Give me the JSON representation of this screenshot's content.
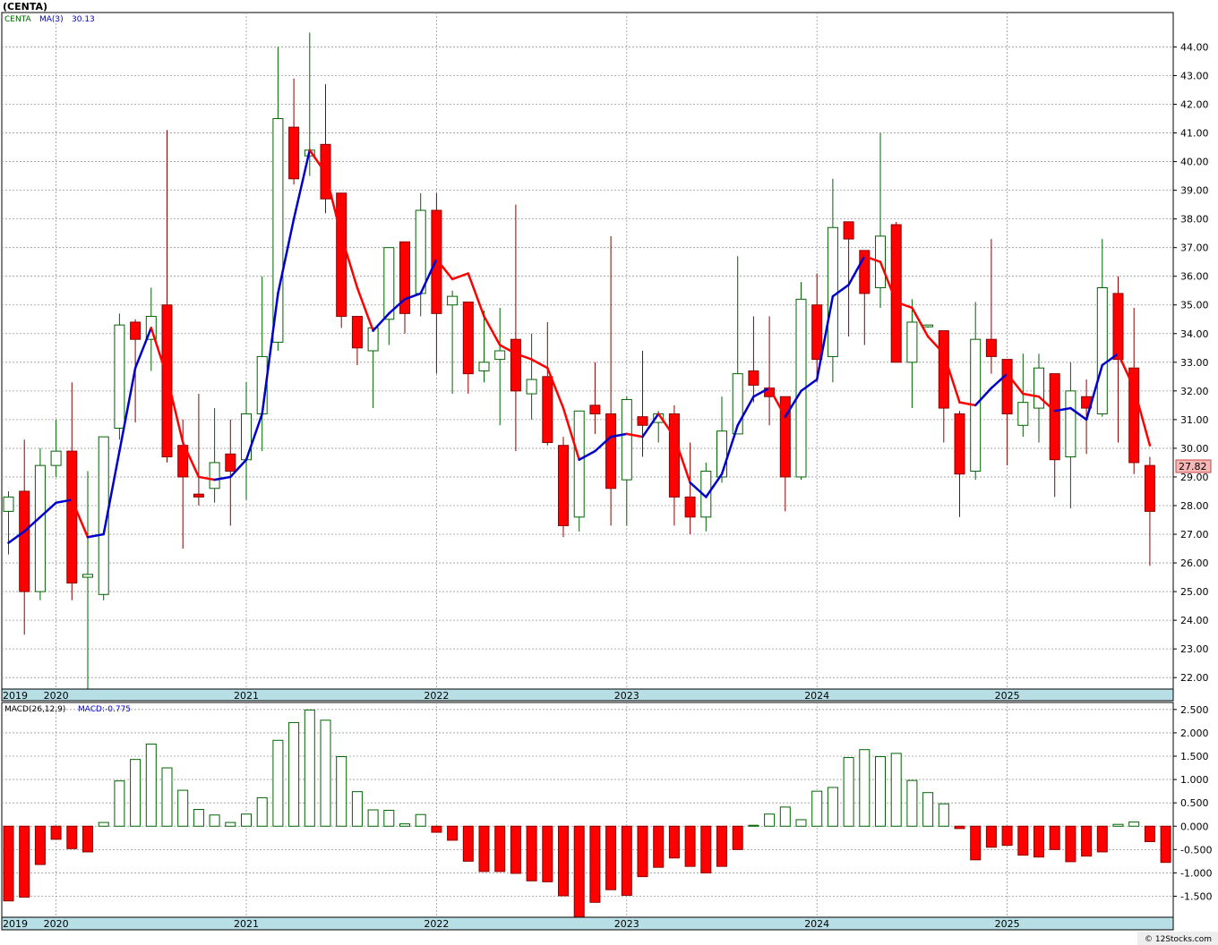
{
  "chart_data": [
    {
      "type": "candlestick",
      "title": "(CENTA)",
      "legend": [
        {
          "label": "CENTA",
          "color": "#006400"
        },
        {
          "label": "MA(3)",
          "color": "#0000cc"
        },
        {
          "label": "30.13",
          "color": "#0000cc"
        }
      ],
      "last_price_label": "27.82",
      "ylim": [
        21.6,
        45.2
      ],
      "y_ticks": [
        "22.00",
        "23.00",
        "24.00",
        "25.00",
        "26.00",
        "27.00",
        "28.00",
        "29.00",
        "30.00",
        "31.00",
        "32.00",
        "33.00",
        "34.00",
        "35.00",
        "36.00",
        "37.00",
        "38.00",
        "39.00",
        "40.00",
        "41.00",
        "42.00",
        "43.00",
        "44.00"
      ],
      "x_labels": [
        {
          "label": "2019",
          "index": -0.3
        },
        {
          "label": "2020",
          "index": 3.0
        },
        {
          "label": "2021",
          "index": 15.0
        },
        {
          "label": "2022",
          "index": 27.0
        },
        {
          "label": "2023",
          "index": 39.0
        },
        {
          "label": "2024",
          "index": 51.0
        },
        {
          "label": "2025",
          "index": 63.0
        }
      ],
      "candles": [
        [
          27.8,
          28.5,
          26.3,
          28.3
        ],
        [
          28.5,
          30.3,
          23.5,
          25.0
        ],
        [
          25.0,
          30.0,
          24.7,
          29.4
        ],
        [
          29.4,
          31.0,
          29.0,
          29.9
        ],
        [
          29.9,
          32.3,
          24.7,
          25.3
        ],
        [
          25.5,
          29.2,
          21.5,
          25.6
        ],
        [
          24.9,
          30.4,
          24.7,
          30.4
        ],
        [
          30.7,
          34.7,
          30.3,
          34.3
        ],
        [
          34.4,
          34.5,
          30.9,
          33.8
        ],
        [
          33.8,
          35.6,
          32.7,
          34.6
        ],
        [
          35.0,
          41.1,
          29.5,
          29.7
        ],
        [
          30.1,
          31.0,
          26.5,
          29.0
        ],
        [
          28.4,
          31.9,
          28.0,
          28.3
        ],
        [
          28.6,
          31.4,
          28.1,
          29.5
        ],
        [
          29.8,
          31.0,
          27.3,
          29.2
        ],
        [
          29.6,
          32.3,
          28.2,
          31.2
        ],
        [
          31.2,
          36.0,
          29.9,
          33.2
        ],
        [
          33.7,
          44.0,
          33.4,
          41.5
        ],
        [
          41.2,
          42.9,
          39.2,
          39.4
        ],
        [
          40.2,
          44.5,
          39.5,
          40.4
        ],
        [
          40.6,
          42.7,
          38.2,
          38.7
        ],
        [
          38.9,
          38.9,
          34.2,
          34.6
        ],
        [
          34.6,
          34.6,
          32.9,
          33.5
        ],
        [
          33.4,
          34.0,
          31.4,
          34.2
        ],
        [
          34.5,
          36.1,
          33.6,
          37.0
        ],
        [
          37.2,
          37.2,
          34.0,
          34.7
        ],
        [
          35.4,
          38.9,
          34.6,
          38.3
        ],
        [
          38.3,
          38.9,
          32.6,
          34.7
        ],
        [
          35.0,
          35.5,
          31.9,
          35.3
        ],
        [
          35.1,
          35.1,
          31.9,
          32.6
        ],
        [
          32.7,
          34.8,
          32.3,
          33.0
        ],
        [
          33.1,
          34.9,
          30.8,
          33.4
        ],
        [
          33.8,
          38.5,
          29.9,
          32.0
        ],
        [
          31.9,
          34.0,
          31.0,
          32.4
        ],
        [
          32.5,
          34.4,
          30.1,
          30.2
        ],
        [
          30.1,
          30.4,
          26.9,
          27.3
        ],
        [
          27.6,
          31.3,
          27.1,
          31.3
        ],
        [
          31.5,
          33.0,
          30.5,
          31.2
        ],
        [
          31.2,
          37.4,
          27.3,
          28.6
        ],
        [
          28.9,
          31.8,
          27.3,
          31.7
        ],
        [
          31.1,
          33.4,
          29.7,
          30.8
        ],
        [
          30.9,
          31.3,
          30.2,
          31.2
        ],
        [
          31.2,
          31.5,
          27.3,
          28.3
        ],
        [
          28.3,
          30.2,
          27.0,
          27.6
        ],
        [
          27.6,
          29.5,
          27.1,
          29.2
        ],
        [
          29.0,
          31.8,
          28.8,
          30.6
        ],
        [
          30.5,
          36.7,
          30.8,
          32.6
        ],
        [
          32.7,
          34.6,
          31.6,
          32.2
        ],
        [
          32.1,
          34.6,
          30.8,
          31.8
        ],
        [
          31.8,
          31.3,
          27.8,
          29.0
        ],
        [
          29.0,
          35.8,
          28.9,
          35.2
        ],
        [
          35.0,
          36.1,
          32.3,
          33.1
        ],
        [
          33.2,
          39.4,
          32.3,
          37.7
        ],
        [
          37.9,
          37.9,
          33.9,
          37.3
        ],
        [
          36.9,
          36.9,
          33.6,
          35.4
        ],
        [
          35.6,
          41.0,
          34.9,
          37.4
        ],
        [
          37.8,
          37.9,
          33.0,
          33.0
        ],
        [
          33.0,
          35.2,
          31.4,
          34.4
        ],
        [
          34.3,
          34.3,
          34.2,
          34.3
        ],
        [
          34.1,
          34.1,
          30.2,
          31.4
        ],
        [
          31.2,
          31.3,
          27.6,
          29.1
        ],
        [
          29.2,
          35.1,
          28.9,
          33.8
        ],
        [
          33.8,
          37.3,
          32.6,
          33.2
        ],
        [
          33.1,
          33.1,
          29.4,
          31.2
        ],
        [
          30.8,
          33.3,
          30.4,
          31.6
        ],
        [
          31.4,
          33.3,
          30.2,
          32.8
        ],
        [
          32.6,
          32.6,
          28.3,
          29.6
        ],
        [
          29.7,
          33.0,
          27.9,
          32.0
        ],
        [
          31.8,
          32.4,
          29.8,
          31.4
        ],
        [
          31.2,
          37.3,
          31.1,
          35.6
        ],
        [
          35.4,
          36.0,
          30.2,
          33.1
        ],
        [
          32.8,
          34.9,
          29.1,
          29.5
        ],
        [
          29.4,
          29.7,
          25.9,
          27.8
        ]
      ],
      "ma3": [
        26.7,
        27.1,
        27.6,
        28.1,
        28.2,
        26.9,
        27.0,
        29.9,
        32.8,
        34.2,
        32.5,
        30.2,
        29.0,
        28.9,
        29.0,
        29.6,
        31.2,
        35.4,
        38.0,
        40.4,
        39.6,
        37.4,
        35.6,
        34.1,
        34.7,
        35.2,
        35.4,
        36.6,
        35.9,
        36.1,
        34.6,
        33.6,
        33.3,
        33.1,
        32.8,
        31.4,
        29.6,
        29.9,
        30.4,
        30.5,
        30.4,
        31.2,
        30.4,
        28.8,
        28.3,
        29.1,
        30.8,
        31.8,
        32.1,
        31.1,
        32.0,
        32.4,
        35.3,
        35.7,
        36.7,
        36.5,
        35.1,
        34.9,
        33.9,
        33.3,
        31.6,
        31.5,
        32.1,
        32.6,
        31.9,
        31.8,
        31.3,
        31.4,
        31.0,
        32.9,
        33.3,
        32.1,
        30.1
      ],
      "ma3_colors": [
        "#0000cc",
        "#0000cc",
        "#0000cc",
        "#0000cc",
        "#ff0000",
        "#0000cc",
        "#0000cc",
        "#0000cc",
        "#0000cc",
        "#ff0000",
        "#ff0000",
        "#ff0000",
        "#ff0000",
        "#0000cc",
        "#0000cc",
        "#0000cc",
        "#0000cc",
        "#0000cc",
        "#0000cc",
        "#ff0000",
        "#ff0000",
        "#ff0000",
        "#ff0000",
        "#0000cc",
        "#0000cc",
        "#0000cc",
        "#0000cc",
        "#ff0000",
        "#ff0000",
        "#ff0000",
        "#ff0000",
        "#ff0000",
        "#ff0000",
        "#ff0000",
        "#ff0000",
        "#ff0000",
        "#0000cc",
        "#0000cc",
        "#0000cc",
        "#ff0000",
        "#0000cc",
        "#ff0000",
        "#ff0000",
        "#0000cc",
        "#0000cc",
        "#0000cc",
        "#0000cc",
        "#0000cc",
        "#ff0000",
        "#0000cc",
        "#0000cc",
        "#0000cc",
        "#0000cc",
        "#0000cc",
        "#ff0000",
        "#ff0000",
        "#ff0000",
        "#ff0000",
        "#ff0000",
        "#ff0000",
        "#ff0000",
        "#0000cc",
        "#0000cc",
        "#ff0000",
        "#ff0000",
        "#ff0000",
        "#0000cc",
        "#0000cc",
        "#0000cc",
        "#0000cc",
        "#ff0000",
        "#ff0000"
      ]
    },
    {
      "type": "bar",
      "title": "MACD(26,12,9)",
      "legend_value": "MACD:-0.775",
      "ylim": [
        -1.95,
        2.65
      ],
      "y_ticks": [
        "2.500",
        "2.000",
        "1.500",
        "1.000",
        "0.500",
        "0.000",
        "-0.500",
        "-1.000",
        "-1.500"
      ],
      "x_labels": [
        {
          "label": "2019",
          "index": -0.3
        },
        {
          "label": "2020",
          "index": 3.0
        },
        {
          "label": "2021",
          "index": 15.0
        },
        {
          "label": "2022",
          "index": 27.0
        },
        {
          "label": "2023",
          "index": 39.0
        },
        {
          "label": "2024",
          "index": 51.0
        },
        {
          "label": "2025",
          "index": 63.0
        }
      ],
      "values": [
        -1.6,
        -1.52,
        -0.82,
        -0.28,
        -0.48,
        -0.55,
        0.08,
        0.97,
        1.43,
        1.76,
        1.25,
        0.77,
        0.36,
        0.24,
        0.08,
        0.26,
        0.61,
        1.84,
        2.22,
        2.49,
        2.27,
        1.49,
        0.74,
        0.35,
        0.34,
        0.05,
        0.25,
        -0.13,
        -0.3,
        -0.75,
        -0.97,
        -0.97,
        -1.01,
        -1.17,
        -1.19,
        -1.49,
        -1.95,
        -1.63,
        -1.36,
        -1.48,
        -1.08,
        -0.88,
        -0.68,
        -0.86,
        -1.0,
        -0.86,
        -0.5,
        0.02,
        0.26,
        0.41,
        0.14,
        0.75,
        0.83,
        1.47,
        1.64,
        1.49,
        1.56,
        0.98,
        0.72,
        0.48,
        -0.05,
        -0.72,
        -0.45,
        -0.41,
        -0.62,
        -0.66,
        -0.5,
        -0.76,
        -0.64,
        -0.55,
        0.04,
        0.09,
        -0.33,
        -0.775
      ]
    }
  ],
  "footer": {
    "copyright": "© 12Stocks.com"
  }
}
